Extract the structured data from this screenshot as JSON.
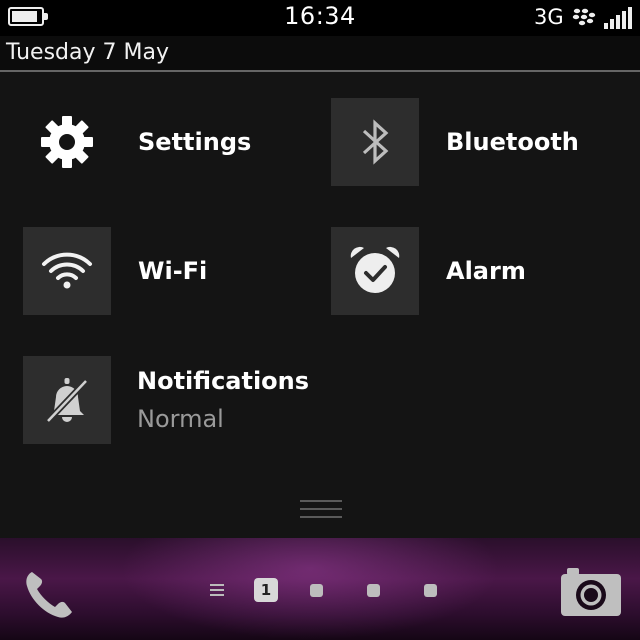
{
  "status_bar": {
    "battery_level": 0.9,
    "time": "16:34",
    "network": "3G"
  },
  "date": "Tuesday 7 May",
  "quick_settings": {
    "settings": {
      "label": "Settings",
      "icon": "gear-icon"
    },
    "bluetooth": {
      "label": "Bluetooth",
      "icon": "bluetooth-icon"
    },
    "wifi": {
      "label": "Wi-Fi",
      "icon": "wifi-icon"
    },
    "alarm": {
      "label": "Alarm",
      "icon": "alarm-clock-icon"
    },
    "notifications": {
      "label": "Notifications",
      "status": "Normal",
      "icon": "bell-muted-icon"
    }
  },
  "dock": {
    "current_page": "1",
    "page_count": 4
  },
  "colors": {
    "panel_bg": "#141414",
    "tile_box": "#2d2d2d",
    "secondary_text": "#9a9a9a"
  }
}
